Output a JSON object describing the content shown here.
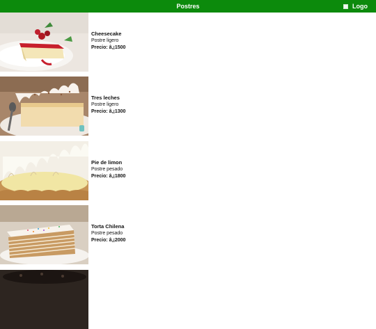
{
  "header": {
    "title": "Postres",
    "logo_alt": "Logo"
  },
  "desserts": [
    {
      "name": "Cheesecake",
      "type": "Postre ligero",
      "price": "Precio: â‚¡1500",
      "image": "cheesecake-photo"
    },
    {
      "name": "Tres leches",
      "type": "Postre ligero",
      "price": "Precio: â‚¡1300",
      "image": "tres-leches-photo"
    },
    {
      "name": "Pie de limon",
      "type": "Postre pesado",
      "price": "Precio: â‚¡1800",
      "image": "lemon-pie-photo"
    },
    {
      "name": "Torta Chilena",
      "type": "Postre pesado",
      "price": "Precio: â‚¡2000",
      "image": "torta-chilena-photo"
    },
    {
      "name": "",
      "type": "",
      "price": "",
      "image": "chocolate-cake-photo"
    }
  ],
  "colors": {
    "header_bg": "#0c8a0c",
    "header_text": "#ffffff"
  }
}
